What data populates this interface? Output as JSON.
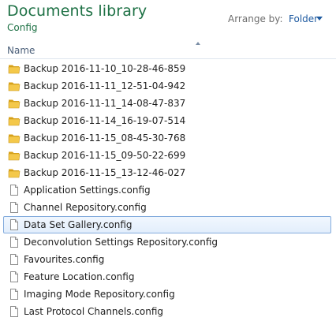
{
  "header": {
    "title": "Documents library",
    "subtitle": "Config",
    "arrange_label": "Arrange by:",
    "arrange_value": "Folder"
  },
  "column": {
    "name_label": "Name"
  },
  "accent_color": "#1e7145",
  "items": [
    {
      "label": "Backup 2016-11-10_10-28-46-859",
      "type": "folder",
      "icon": "folder-icon"
    },
    {
      "label": "Backup 2016-11-11_12-51-04-942",
      "type": "folder",
      "icon": "folder-icon"
    },
    {
      "label": "Backup 2016-11-11_14-08-47-837",
      "type": "folder",
      "icon": "folder-icon"
    },
    {
      "label": "Backup 2016-11-14_16-19-07-514",
      "type": "folder",
      "icon": "folder-icon"
    },
    {
      "label": "Backup 2016-11-15_08-45-30-768",
      "type": "folder",
      "icon": "folder-icon"
    },
    {
      "label": "Backup 2016-11-15_09-50-22-699",
      "type": "folder",
      "icon": "folder-icon"
    },
    {
      "label": "Backup 2016-11-15_13-12-46-027",
      "type": "folder",
      "icon": "folder-icon"
    },
    {
      "label": "Application Settings.config",
      "type": "file",
      "icon": "file-icon"
    },
    {
      "label": "Channel Repository.config",
      "type": "file",
      "icon": "file-icon"
    },
    {
      "label": "Data Set Gallery.config",
      "type": "file",
      "icon": "file-icon",
      "selected": true
    },
    {
      "label": "Deconvolution Settings Repository.config",
      "type": "file",
      "icon": "file-icon"
    },
    {
      "label": "Favourites.config",
      "type": "file",
      "icon": "file-icon"
    },
    {
      "label": "Feature Location.config",
      "type": "file",
      "icon": "file-icon"
    },
    {
      "label": "Imaging Mode Repository.config",
      "type": "file",
      "icon": "file-icon"
    },
    {
      "label": "Last Protocol Channels.config",
      "type": "file",
      "icon": "file-icon"
    }
  ]
}
